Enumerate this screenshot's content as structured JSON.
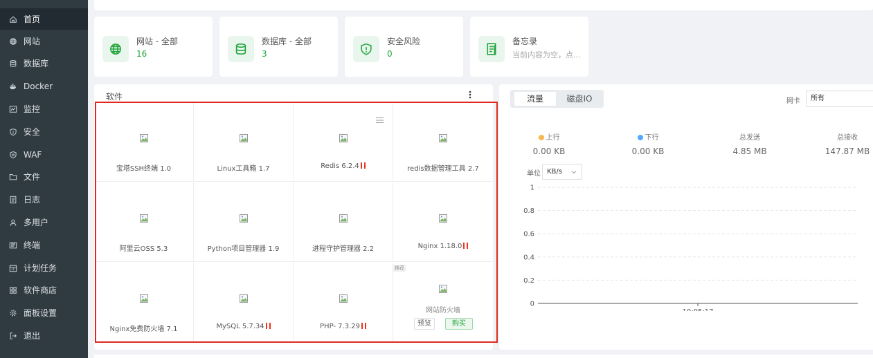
{
  "sidebar": {
    "items": [
      {
        "label": "首页",
        "icon": "home-icon",
        "active": true
      },
      {
        "label": "网站",
        "icon": "globe-icon"
      },
      {
        "label": "数据库",
        "icon": "database-icon"
      },
      {
        "label": "Docker",
        "icon": "docker-icon"
      },
      {
        "label": "监控",
        "icon": "monitor-icon"
      },
      {
        "label": "安全",
        "icon": "shield-icon"
      },
      {
        "label": "WAF",
        "icon": "waf-shield-icon"
      },
      {
        "label": "文件",
        "icon": "folder-icon"
      },
      {
        "label": "日志",
        "icon": "log-icon"
      },
      {
        "label": "多用户",
        "icon": "users-icon"
      },
      {
        "label": "终端",
        "icon": "terminal-icon"
      },
      {
        "label": "计划任务",
        "icon": "calendar-icon"
      },
      {
        "label": "软件商店",
        "icon": "app-store-icon"
      },
      {
        "label": "面板设置",
        "icon": "gear-icon"
      },
      {
        "label": "退出",
        "icon": "logout-icon"
      }
    ]
  },
  "stats": [
    {
      "label": "网站 - 全部",
      "value": "16",
      "icon": "globe-icon"
    },
    {
      "label": "数据库 - 全部",
      "value": "3",
      "icon": "database-icon"
    },
    {
      "label": "安全风险",
      "value": "0",
      "icon": "shield-icon"
    },
    {
      "label": "备忘录",
      "value": "当前内容为空，点...",
      "icon": "memo-icon"
    }
  ],
  "software": {
    "title": "软件",
    "items": [
      {
        "name": "宝塔SSH终端 1.0",
        "paused": false
      },
      {
        "name": "Linux工具箱 1.7",
        "paused": false
      },
      {
        "name": "Redis 6.2.4",
        "paused": true
      },
      {
        "name": "redis数据管理工具 2.7",
        "paused": false
      },
      {
        "name": "阿里云OSS 5.3",
        "paused": false
      },
      {
        "name": "Python项目管理器 1.9",
        "paused": false
      },
      {
        "name": "进程守护管理器 2.2",
        "paused": false
      },
      {
        "name": "Nginx 1.18.0",
        "paused": true
      },
      {
        "name": "Nginx免费防火墙 7.1",
        "paused": false
      },
      {
        "name": "MySQL 5.7.34",
        "paused": true
      },
      {
        "name": "PHP- 7.3.29",
        "paused": true
      }
    ],
    "recommend": {
      "badge": "推荐",
      "name": "网站防火墙",
      "preview": "预览",
      "buy": "购买"
    }
  },
  "network": {
    "tabs": [
      "流量",
      "磁盘IO"
    ],
    "active_tab": "流量",
    "nic_label": "网卡",
    "nic_value": "所有",
    "summary": [
      {
        "label": "上行",
        "value": "0.00 KB",
        "dot": "#f7b851"
      },
      {
        "label": "下行",
        "value": "0.00 KB",
        "dot": "#52a9ff"
      },
      {
        "label": "总发送",
        "value": "4.85 MB"
      },
      {
        "label": "总接收",
        "value": "147.87 MB"
      }
    ],
    "unit_label": "单位",
    "unit_value": "KB/s"
  },
  "chart_data": {
    "type": "line",
    "x": [
      "10:05:17"
    ],
    "series": [],
    "yticks": [
      "1",
      "0.8",
      "0.6",
      "0.4",
      "0.2",
      "0"
    ],
    "ylim": [
      0,
      1
    ],
    "grid": true
  },
  "colors": {
    "accent": "#20a53a",
    "sidebar": "#2f3a41",
    "highlight_border": "#e0281d",
    "paused": "#f0331e"
  }
}
